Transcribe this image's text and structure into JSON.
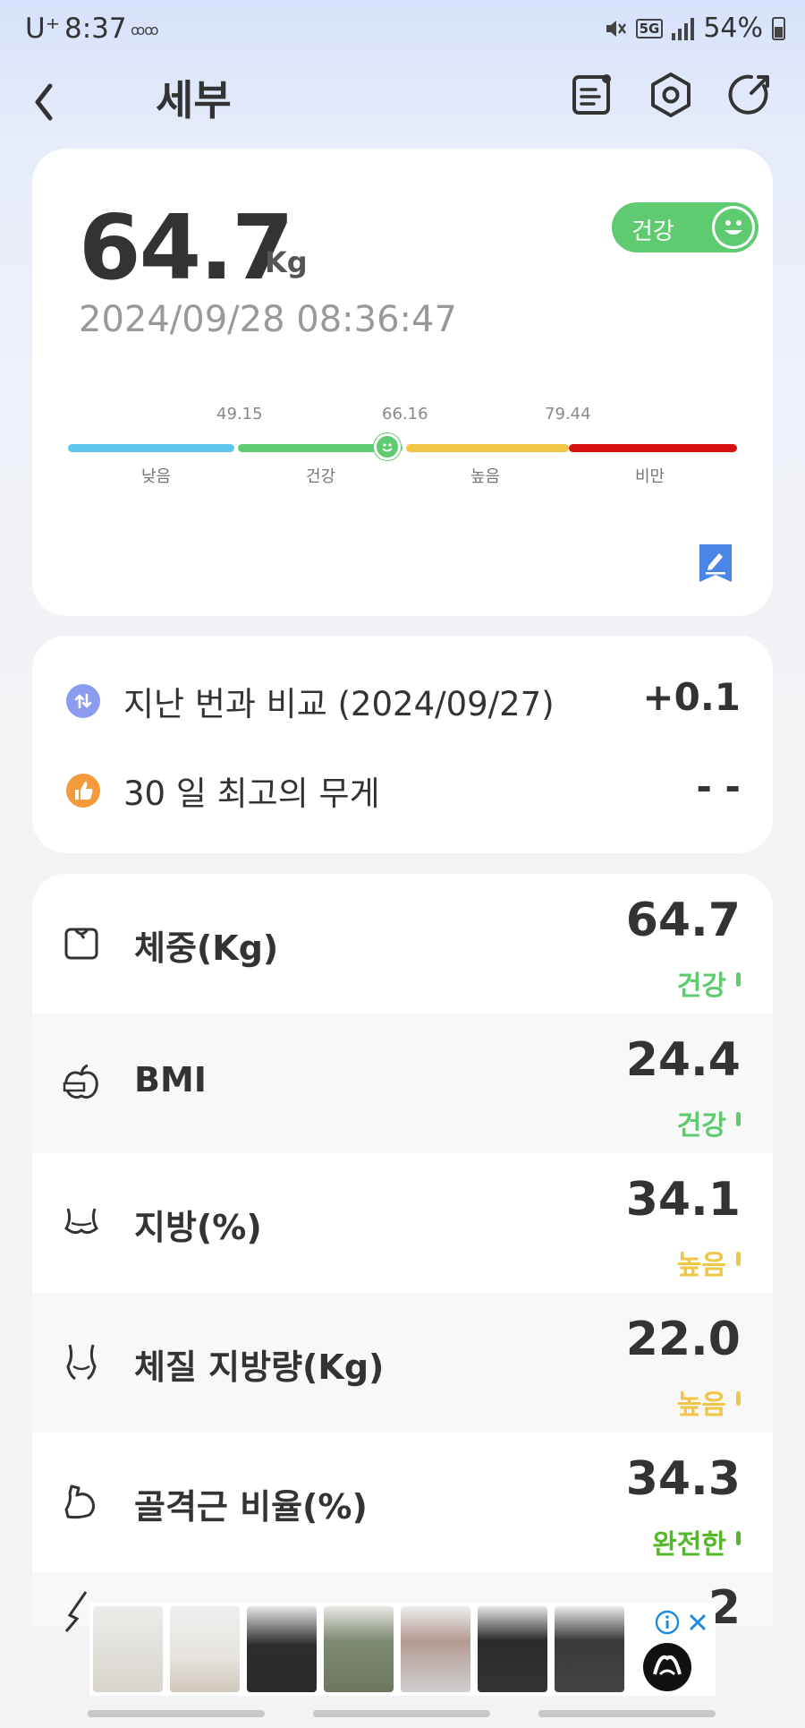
{
  "status_bar": {
    "carrier": "U⁺",
    "time": "8:37",
    "notif_icons": "ꝏꝏ",
    "network": "5G",
    "battery": "54%"
  },
  "header": {
    "title": "세부"
  },
  "summary": {
    "weight": "64.7",
    "unit": "Kg",
    "datetime": "2024/09/28 08:36:47",
    "status_label": "건강",
    "scale": {
      "thresholds": [
        "49.15",
        "66.16",
        "79.44"
      ],
      "zones": [
        "낮음",
        "건강",
        "높음",
        "비만"
      ],
      "zone_colors": [
        "#5ec6ea",
        "#5fcb70",
        "#f1c545",
        "#d60f0f"
      ]
    }
  },
  "compare": {
    "last_label": "지난 번과 비교 (2024/09/27)",
    "last_value": "+0.1",
    "max_label": "30 일 최고의 무게",
    "max_value": "- -"
  },
  "metrics": [
    {
      "name": "체중(Kg)",
      "value": "64.7",
      "status": "건강",
      "color": "#5fcb70",
      "icon": "scale-icon"
    },
    {
      "name": "BMI",
      "value": "24.4",
      "status": "건강",
      "color": "#5fcb70",
      "icon": "apple-tape-icon"
    },
    {
      "name": "지방(%)",
      "value": "34.1",
      "status": "높음",
      "color": "#f1c545",
      "icon": "body-fat-icon"
    },
    {
      "name": "체질 지방량(Kg)",
      "value": "22.0",
      "status": "높음",
      "color": "#f1c545",
      "icon": "torso-icon"
    },
    {
      "name": "골격근 비율(%)",
      "value": "34.3",
      "status": "완전한",
      "color": "#55b82a",
      "icon": "muscle-icon"
    },
    {
      "name": "",
      "value": "2",
      "status": "",
      "color": "#55b82a",
      "icon": "figure-icon"
    }
  ]
}
